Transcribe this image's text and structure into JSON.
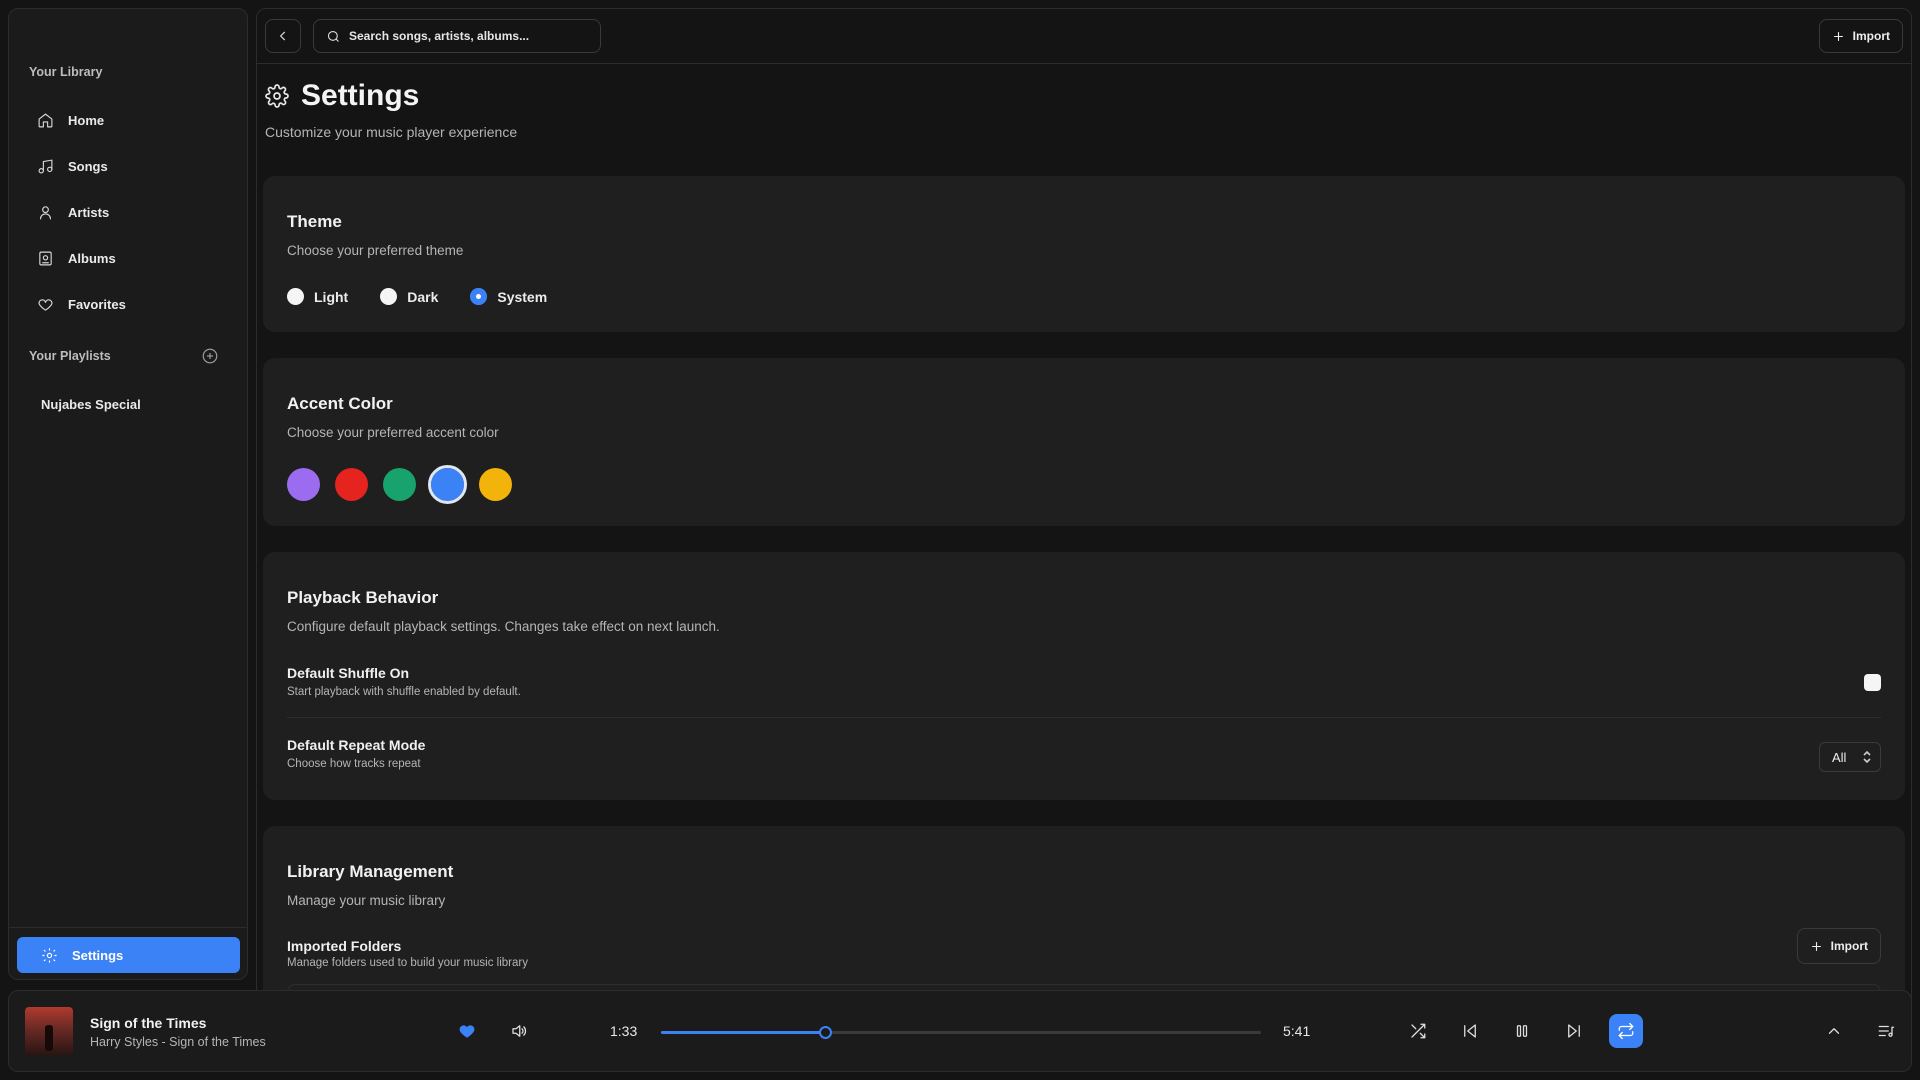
{
  "sidebar": {
    "library_title": "Your Library",
    "nav": [
      {
        "label": "Home",
        "icon": "home-icon"
      },
      {
        "label": "Songs",
        "icon": "music-note-icon"
      },
      {
        "label": "Artists",
        "icon": "user-icon"
      },
      {
        "label": "Albums",
        "icon": "album-icon"
      },
      {
        "label": "Favorites",
        "icon": "heart-icon"
      }
    ],
    "playlists_title": "Your Playlists",
    "playlists": [
      "Nujabes Special"
    ],
    "settings_label": "Settings"
  },
  "topbar": {
    "search_placeholder": "Search songs, artists, albums...",
    "import_label": "Import"
  },
  "page": {
    "title": "Settings",
    "subtitle": "Customize your music player experience"
  },
  "theme": {
    "title": "Theme",
    "subtitle": "Choose your preferred theme",
    "options": [
      "Light",
      "Dark",
      "System"
    ],
    "selected": "System"
  },
  "accent": {
    "title": "Accent Color",
    "subtitle": "Choose your preferred accent color",
    "colors": [
      "#9b6cf0",
      "#e5241f",
      "#17a36b",
      "#3b82f6",
      "#f2b30a"
    ],
    "selected": "#3b82f6"
  },
  "playback": {
    "title": "Playback Behavior",
    "subtitle": "Configure default playback settings. Changes take effect on next launch.",
    "shuffle_title": "Default Shuffle On",
    "shuffle_sub": "Start playback with shuffle enabled by default.",
    "repeat_title": "Default Repeat Mode",
    "repeat_sub": "Choose how tracks repeat",
    "repeat_value": "All"
  },
  "library": {
    "title": "Library Management",
    "subtitle": "Manage your music library",
    "folders_title": "Imported Folders",
    "folders_sub": "Manage folders used to build your music library",
    "import_label": "Import"
  },
  "player": {
    "title": "Sign of the Times",
    "subtitle": "Harry Styles - Sign of the Times",
    "elapsed": "1:33",
    "duration": "5:41",
    "progress": 0.2727
  },
  "colors": {
    "accent": "#3b82f6"
  }
}
